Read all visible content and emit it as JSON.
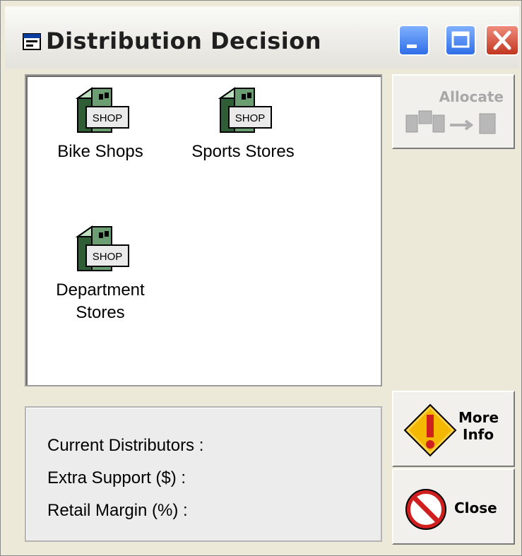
{
  "window": {
    "title": "Distribution Decision",
    "controls": {
      "minimize": "minimize",
      "maximize": "maximize",
      "close": "close"
    }
  },
  "distributors": [
    {
      "label": "Bike Shops",
      "icon_text": "SHOP"
    },
    {
      "label": "Sports Stores",
      "icon_text": "SHOP"
    },
    {
      "label_line1": "Department",
      "label_line2": "Stores",
      "icon_text": "SHOP"
    }
  ],
  "info": {
    "current_distributors": "Current Distributors :",
    "extra_support": "Extra Support ($) :",
    "retail_margin": "Retail Margin (%) :"
  },
  "buttons": {
    "allocate": "Allocate",
    "more_info_1": "More",
    "more_info_2": "Info",
    "close": "Close"
  },
  "icons": {
    "app": "app-window-icon",
    "shop": "shop-icon",
    "allocate": "allocate-icon",
    "warning": "warning-icon",
    "no": "prohibited-icon"
  },
  "colors": {
    "title_blue": "#2f6ee6",
    "close_red": "#c2361f",
    "warning_yellow": "#f5b800"
  }
}
